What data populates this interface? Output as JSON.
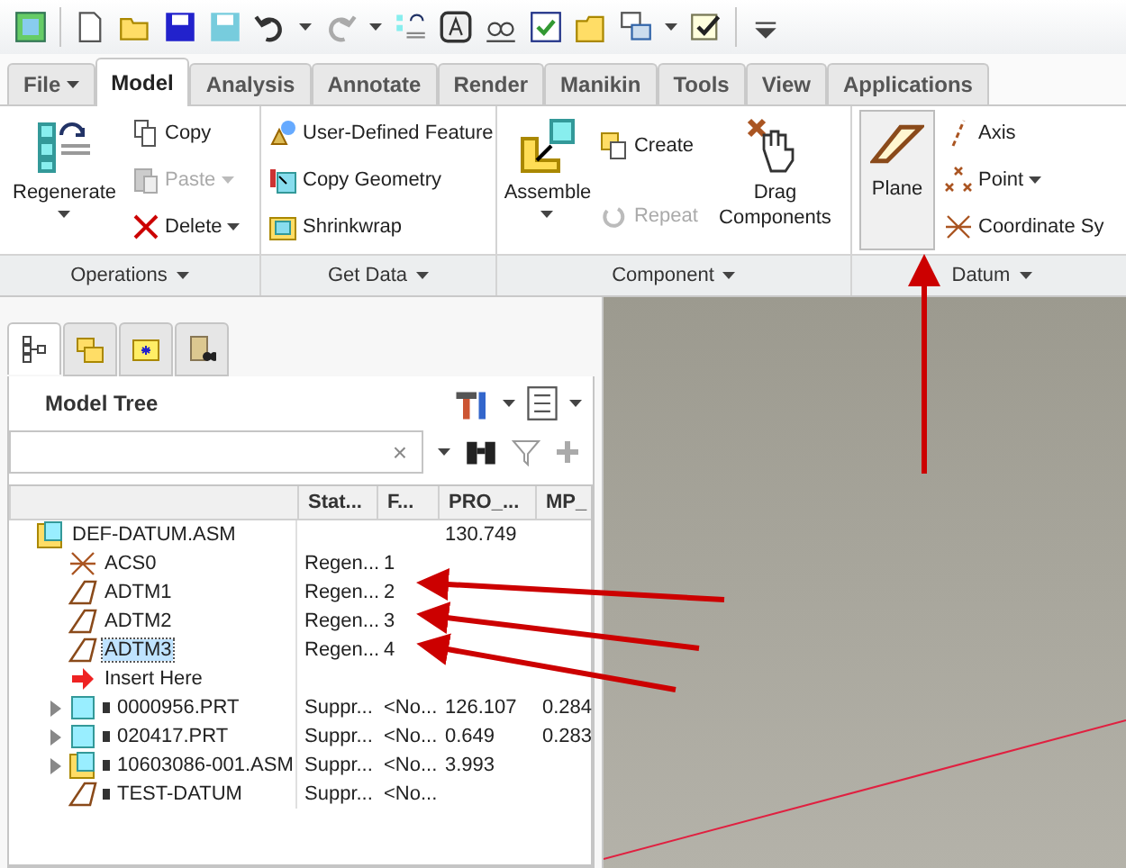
{
  "ribbon_tabs": [
    {
      "label": "File",
      "selected": false,
      "menu": true
    },
    {
      "label": "Model",
      "selected": true
    },
    {
      "label": "Analysis",
      "selected": false
    },
    {
      "label": "Annotate",
      "selected": false
    },
    {
      "label": "Render",
      "selected": false
    },
    {
      "label": "Manikin",
      "selected": false
    },
    {
      "label": "Tools",
      "selected": false
    },
    {
      "label": "View",
      "selected": false
    },
    {
      "label": "Applications",
      "selected": false
    }
  ],
  "ribbon_groups": [
    {
      "label": "Operations",
      "columns": [
        {
          "kind": "large",
          "items": [
            {
              "label": "Regenerate",
              "disabled": false,
              "dropdown": true,
              "highlighted": false
            }
          ]
        },
        {
          "kind": "small",
          "items": [
            {
              "label": "Copy",
              "disabled": false
            },
            {
              "label": "Paste",
              "disabled": true,
              "dropdown": true
            },
            {
              "label": "Delete",
              "disabled": false,
              "dropdown": true
            }
          ]
        }
      ]
    },
    {
      "label": "Get Data",
      "columns": [
        {
          "kind": "small",
          "items": [
            {
              "label": "User-Defined Feature",
              "disabled": false
            },
            {
              "label": "Copy Geometry",
              "disabled": false
            },
            {
              "label": "Shrinkwrap",
              "disabled": false
            }
          ]
        }
      ]
    },
    {
      "label": "Component",
      "columns": [
        {
          "kind": "large",
          "items": [
            {
              "label": "Assemble",
              "disabled": false,
              "dropdown": true,
              "highlighted": false
            }
          ]
        },
        {
          "kind": "small",
          "items": [
            {
              "label": "Create",
              "disabled": false
            },
            {
              "label": "Repeat",
              "disabled": true
            }
          ]
        },
        {
          "kind": "large",
          "items": [
            {
              "label": "Drag Components",
              "disabled": false,
              "highlighted": false
            }
          ]
        }
      ]
    },
    {
      "label": "Datum",
      "columns": [
        {
          "kind": "large",
          "items": [
            {
              "label": "Plane",
              "disabled": false,
              "highlighted": true
            }
          ]
        },
        {
          "kind": "small",
          "items": [
            {
              "label": "Axis",
              "disabled": false
            },
            {
              "label": "Point",
              "disabled": false,
              "dropdown": true
            },
            {
              "label": "Coordinate Sy",
              "disabled": false
            }
          ]
        }
      ]
    }
  ],
  "navigator_tabs": [
    {
      "selected": true
    },
    {
      "selected": false
    },
    {
      "selected": false
    },
    {
      "selected": false
    }
  ],
  "model_tree": {
    "title": "Model Tree",
    "search": {
      "clear": "×"
    },
    "columns": [
      "",
      "Stat...",
      "F...",
      "PRO_...",
      "MP_"
    ],
    "rows": [
      {
        "kind": "assembly",
        "selected": false,
        "cells": [
          "DEF-DATUM.ASM",
          "",
          "",
          "130.749",
          ""
        ],
        "children": [
          {
            "kind": "csys",
            "selected": false,
            "cells": [
              "ACS0",
              "Regen...",
              "1",
              "",
              ""
            ]
          },
          {
            "kind": "plane",
            "selected": false,
            "cells": [
              "ADTM1",
              "Regen...",
              "2",
              "",
              ""
            ]
          },
          {
            "kind": "plane",
            "selected": false,
            "cells": [
              "ADTM2",
              "Regen...",
              "3",
              "",
              ""
            ]
          },
          {
            "kind": "plane",
            "selected": true,
            "cells": [
              "ADTM3",
              "Regen...",
              "4",
              "",
              ""
            ]
          },
          {
            "kind": "insert",
            "selected": false,
            "cells": [
              "Insert Here",
              "",
              "",
              "",
              ""
            ]
          },
          {
            "kind": "part",
            "selected": false,
            "marker": true,
            "expanded": false,
            "cells": [
              "0000956.PRT",
              "Suppr...",
              "<No...",
              "126.107",
              "0.284"
            ]
          },
          {
            "kind": "part",
            "selected": false,
            "marker": true,
            "expanded": false,
            "cells": [
              "020417.PRT",
              "Suppr...",
              "<No...",
              "0.649",
              "0.283"
            ]
          },
          {
            "kind": "assembly",
            "selected": false,
            "marker": true,
            "expanded": false,
            "cells": [
              "10603086-001.ASM",
              "Suppr...",
              "<No...",
              "3.993",
              ""
            ]
          },
          {
            "kind": "plane",
            "selected": false,
            "marker": true,
            "cells": [
              "TEST-DATUM",
              "Suppr...",
              "<No...",
              "",
              ""
            ]
          }
        ]
      }
    ]
  }
}
